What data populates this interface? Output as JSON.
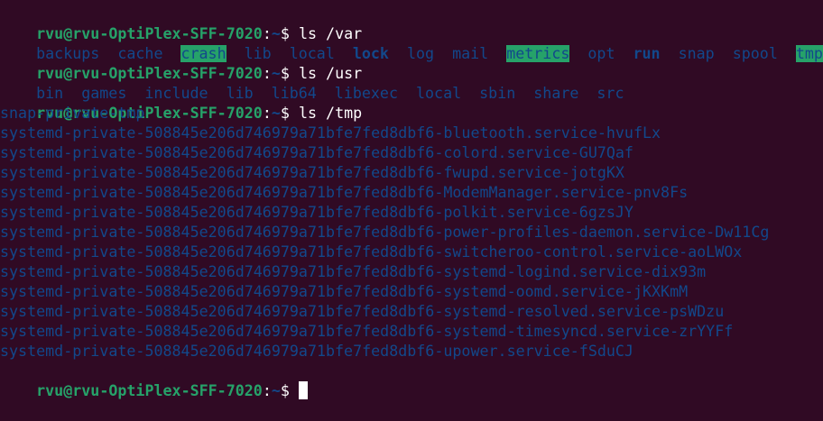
{
  "prompt": {
    "user_host": "rvu@rvu-OptiPlex-SFF-7020",
    "colon": ":",
    "path": "~",
    "symbol": "$"
  },
  "commands": {
    "c1": "ls /var",
    "c2": "ls /usr",
    "c3": "ls /tmp"
  },
  "var_listing": [
    "backups",
    "cache",
    "crash",
    "lib",
    "local",
    "lock",
    "log",
    "mail",
    "metrics",
    "opt",
    "run",
    "snap",
    "spool",
    "tmp"
  ],
  "usr_listing": [
    "bin",
    "games",
    "include",
    "lib",
    "lib64",
    "libexec",
    "local",
    "sbin",
    "share",
    "src"
  ],
  "tmp_listing": [
    "snap-private-tmp",
    "systemd-private-508845e206d746979a71bfe7fed8dbf6-bluetooth.service-hvufLx",
    "systemd-private-508845e206d746979a71bfe7fed8dbf6-colord.service-GU7Qaf",
    "systemd-private-508845e206d746979a71bfe7fed8dbf6-fwupd.service-jotgKX",
    "systemd-private-508845e206d746979a71bfe7fed8dbf6-ModemManager.service-pnv8Fs",
    "systemd-private-508845e206d746979a71bfe7fed8dbf6-polkit.service-6gzsJY",
    "systemd-private-508845e206d746979a71bfe7fed8dbf6-power-profiles-daemon.service-Dw11Cg",
    "systemd-private-508845e206d746979a71bfe7fed8dbf6-switcheroo-control.service-aoLWOx",
    "systemd-private-508845e206d746979a71bfe7fed8dbf6-systemd-logind.service-dix93m",
    "systemd-private-508845e206d746979a71bfe7fed8dbf6-systemd-oomd.service-jKXKmM",
    "systemd-private-508845e206d746979a71bfe7fed8dbf6-systemd-resolved.service-psWDzu",
    "systemd-private-508845e206d746979a71bfe7fed8dbf6-systemd-timesyncd.service-zrYYFf",
    "systemd-private-508845e206d746979a71bfe7fed8dbf6-upower.service-fSduCJ"
  ],
  "colors": {
    "background": "#300a24",
    "prompt_user": "#26a269",
    "prompt_path": "#12488b",
    "directory": "#12488b",
    "highlight_bg": "#26a269",
    "text": "#ffffff"
  }
}
